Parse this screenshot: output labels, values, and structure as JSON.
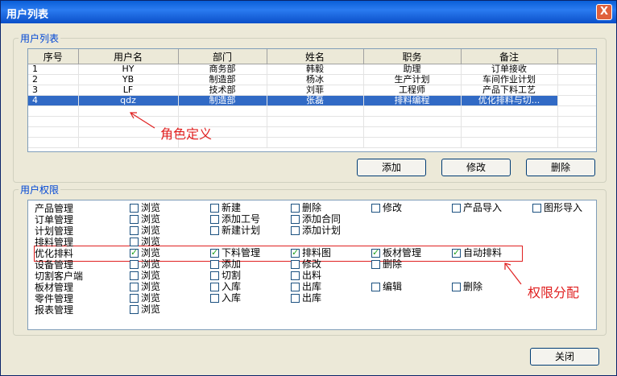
{
  "window": {
    "title": "用户列表",
    "close_glyph": "X"
  },
  "user_list": {
    "legend": "用户列表",
    "columns": [
      "序号",
      "用户名",
      "部门",
      "姓名",
      "职务",
      "备注"
    ],
    "rows": [
      {
        "seq": "1",
        "user": "HY",
        "dept": "商务部",
        "name": "韩毅",
        "title": "助理",
        "note": "订单接收"
      },
      {
        "seq": "2",
        "user": "YB",
        "dept": "制造部",
        "name": "杨冰",
        "title": "生产计划",
        "note": "车间作业计划"
      },
      {
        "seq": "3",
        "user": "LF",
        "dept": "技术部",
        "name": "刘菲",
        "title": "工程师",
        "note": "产品下料工艺"
      },
      {
        "seq": "4",
        "user": "qdz",
        "dept": "制造部",
        "name": "张磊",
        "title": "排料编程",
        "note": "优化排料与切..."
      }
    ],
    "selected_row": "4",
    "add_label": "添加",
    "edit_label": "修改",
    "delete_label": "删除"
  },
  "annotations": {
    "role": "角色定义",
    "perm": "权限分配",
    "color": "#E02020"
  },
  "permissions": {
    "legend": "用户权限",
    "modules": [
      "产品管理",
      "订单管理",
      "计划管理",
      "排料管理",
      "优化排料",
      "设备管理",
      "切割客户端",
      "板材管理",
      "零件管理",
      "报表管理"
    ],
    "checks": {
      "c0": [
        {
          "l": "浏览",
          "v": false
        },
        {
          "l": "浏览",
          "v": false
        },
        {
          "l": "浏览",
          "v": false
        },
        {
          "l": "浏览",
          "v": false
        },
        {
          "l": "浏览",
          "v": true
        },
        {
          "l": "浏览",
          "v": false
        },
        {
          "l": "浏览",
          "v": false
        },
        {
          "l": "浏览",
          "v": false
        },
        {
          "l": "浏览",
          "v": false
        },
        {
          "l": "浏览",
          "v": false
        }
      ],
      "c1": [
        {
          "r": 0,
          "l": "新建",
          "v": false
        },
        {
          "r": 1,
          "l": "添加工号",
          "v": false
        },
        {
          "r": 2,
          "l": "新建计划",
          "v": false
        },
        {
          "r": 4,
          "l": "下料管理",
          "v": true
        },
        {
          "r": 5,
          "l": "添加",
          "v": false
        },
        {
          "r": 6,
          "l": "切割",
          "v": false
        },
        {
          "r": 7,
          "l": "入库",
          "v": false
        },
        {
          "r": 8,
          "l": "入库",
          "v": false
        }
      ],
      "c2": [
        {
          "r": 0,
          "l": "删除",
          "v": false
        },
        {
          "r": 1,
          "l": "添加合同",
          "v": false
        },
        {
          "r": 2,
          "l": "添加计划",
          "v": false
        },
        {
          "r": 4,
          "l": "排料图",
          "v": true
        },
        {
          "r": 5,
          "l": "修改",
          "v": false
        },
        {
          "r": 6,
          "l": "出料",
          "v": false
        },
        {
          "r": 7,
          "l": "出库",
          "v": false
        },
        {
          "r": 8,
          "l": "出库",
          "v": false
        }
      ],
      "c3": [
        {
          "r": 0,
          "l": "修改",
          "v": false
        },
        {
          "r": 4,
          "l": "板材管理",
          "v": true
        },
        {
          "r": 5,
          "l": "删除",
          "v": false
        },
        {
          "r": 7,
          "l": "编辑",
          "v": false
        }
      ],
      "c4": [
        {
          "r": 0,
          "l": "产品导入",
          "v": false
        },
        {
          "r": 4,
          "l": "自动排料",
          "v": true
        },
        {
          "r": 7,
          "l": "删除",
          "v": false
        }
      ],
      "c5": [
        {
          "r": 0,
          "l": "图形导入",
          "v": false
        }
      ]
    }
  },
  "footer": {
    "close_label": "关闭"
  }
}
